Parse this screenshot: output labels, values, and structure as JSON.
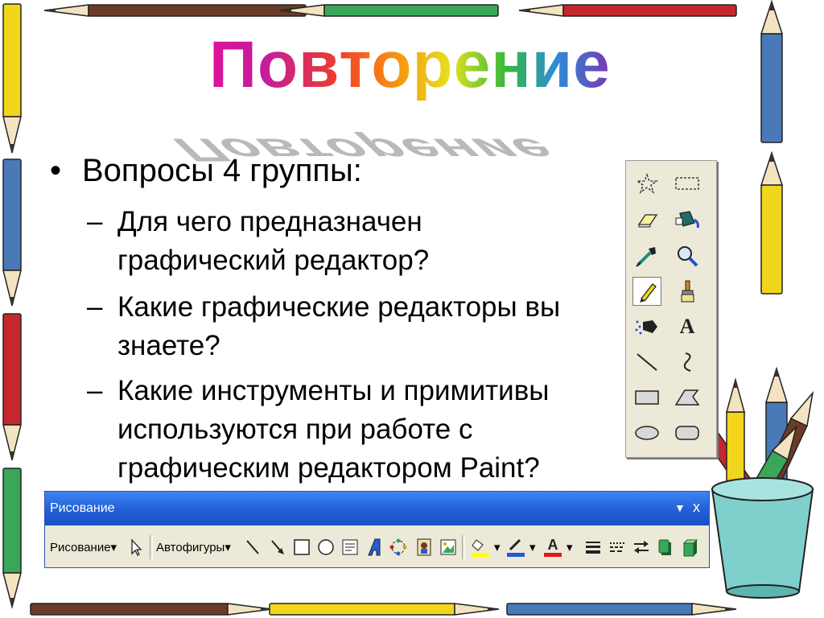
{
  "slide": {
    "title": "Повторение",
    "bullet_main": "Вопросы 4 группы:",
    "bullet_marker": "•",
    "dash": "–",
    "questions": [
      "Для чего предназначен",
      "графический редактор?",
      "Какие графические редакторы вы",
      "знаете?",
      "Какие инструменты и примитивы",
      "используются при работе с",
      "графическим редактором Paint?"
    ]
  },
  "toolbox": {
    "tools": [
      "free-select-icon",
      "rect-select-icon",
      "eraser-icon",
      "fill-bucket-icon",
      "color-picker-icon",
      "magnifier-icon",
      "pencil-icon",
      "brush-icon",
      "airbrush-icon",
      "text-icon",
      "line-icon",
      "curve-icon",
      "rectangle-icon",
      "polygon-icon",
      "ellipse-icon",
      "rounded-rect-icon"
    ],
    "selected": "pencil-icon",
    "text_tool_glyph": "A"
  },
  "drawbar": {
    "title": "Рисование",
    "close_glyph": "x",
    "menu_glyph": "▼",
    "draw_menu": "Рисование",
    "autoshapes_menu": "Автофигуры",
    "dropdown_glyph": "▾",
    "font_color_glyph": "A"
  },
  "colors": {
    "title_bar": "#2461d9",
    "fill_color": "#ffff00",
    "line_color": "#1e5bd6",
    "font_color": "#e01818"
  }
}
